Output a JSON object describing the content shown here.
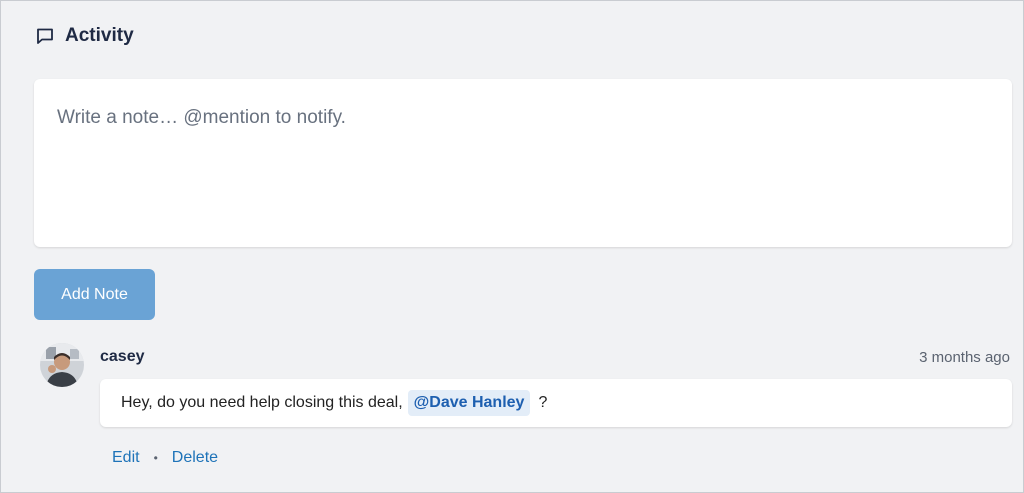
{
  "header": {
    "title": "Activity",
    "icon": "comment-icon"
  },
  "note_input": {
    "value": "",
    "placeholder": "Write a note… @mention to notify."
  },
  "add_note_button": {
    "label": "Add Note",
    "color": "#6aa3d5"
  },
  "comments": [
    {
      "author": "casey",
      "timestamp": "3 months ago",
      "text_before": "Hey, do you need help closing this deal,",
      "mention": "@Dave Hanley",
      "text_after": "?",
      "actions": {
        "edit": "Edit",
        "delete": "Delete"
      }
    }
  ],
  "colors": {
    "background": "#f1f2f4",
    "link": "#1e73b8",
    "mention_text": "#1d5fb0",
    "mention_bg": "#e3edf8",
    "heading": "#1f2a44"
  }
}
